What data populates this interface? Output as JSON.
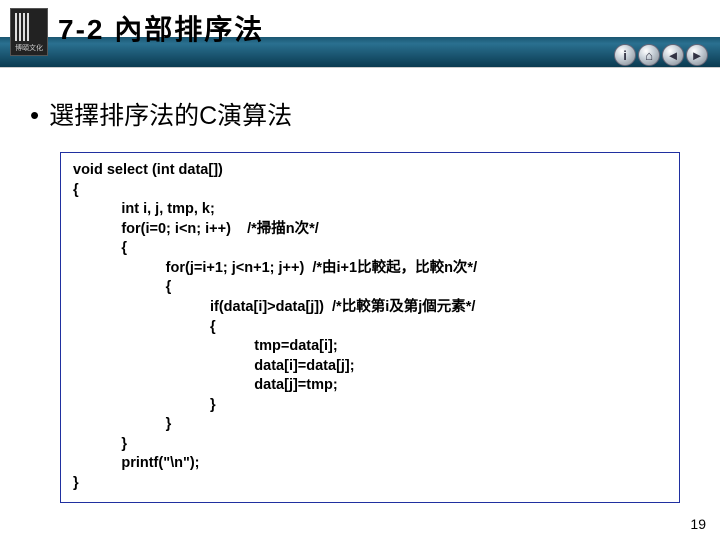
{
  "header": {
    "logo_caption": "博頤文化",
    "title": "7-2 內部排序法"
  },
  "nav": {
    "info_glyph": "i",
    "home_glyph": "⌂",
    "prev_glyph": "◄",
    "next_glyph": "►"
  },
  "bullet": {
    "text": "選擇排序法的C演算法"
  },
  "code": {
    "line1": "void select (int data[])",
    "line2": "{",
    "line3": "int i, j, tmp, k;",
    "line4a": "for(i=0; i<n; i++)",
    "line4b": "/*掃描n次*/",
    "line5": "{",
    "line6a": "for(j=i+1; j<n+1; j++)",
    "line6b": "/*由i+1比較起，比較n次*/",
    "line7": "{",
    "line8a": "if(data[i]>data[j])",
    "line8b": "/*比較第i及第j個元素*/",
    "line9": "{",
    "line10": "tmp=data[i];",
    "line11": "data[i]=data[j];",
    "line12": "data[j]=tmp;",
    "line13": "}",
    "line14": "}",
    "line15": "}",
    "line16": "printf(\"\\n\");",
    "line17": "}"
  },
  "page_number": "19"
}
